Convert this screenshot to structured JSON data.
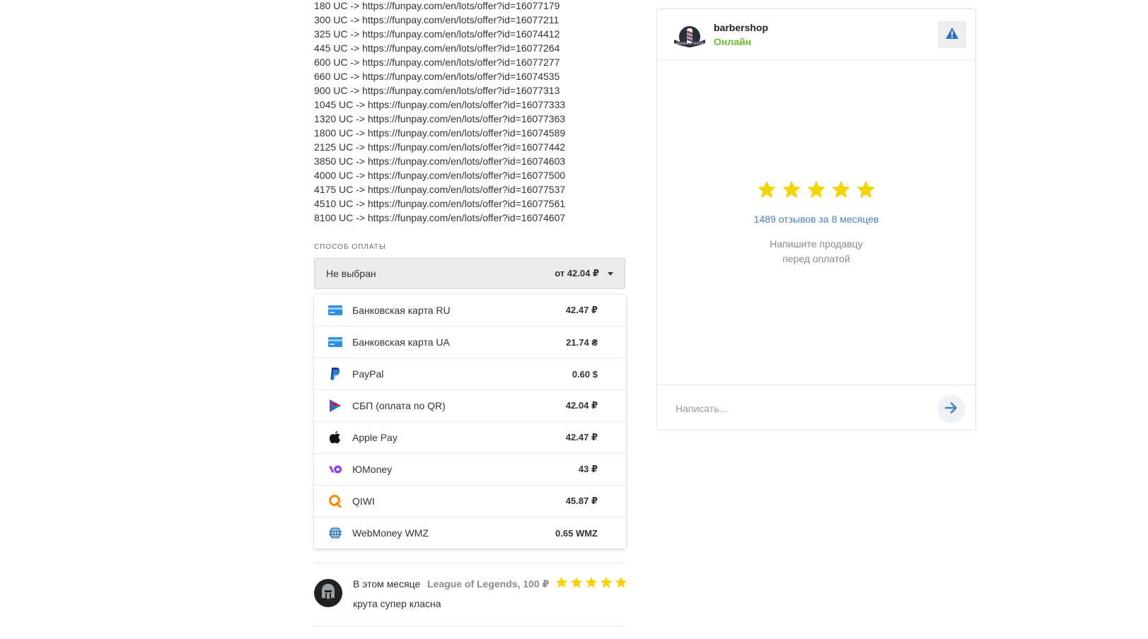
{
  "offers": [
    "180 UC -> https://funpay.com/en/lots/offer?id=16077179",
    "300 UC -> https://funpay.com/en/lots/offer?id=16077211",
    "325 UC -> https://funpay.com/en/lots/offer?id=16074412",
    "445 UC -> https://funpay.com/en/lots/offer?id=16077264",
    "600 UC -> https://funpay.com/en/lots/offer?id=16077277",
    "660 UC -> https://funpay.com/en/lots/offer?id=16074535",
    "900 UC -> https://funpay.com/en/lots/offer?id=16077313",
    "1045 UC -> https://funpay.com/en/lots/offer?id=16077333",
    "1320 UC -> https://funpay.com/en/lots/offer?id=16077363",
    "1800 UC -> https://funpay.com/en/lots/offer?id=16074589",
    "2125 UC -> https://funpay.com/en/lots/offer?id=16077442",
    "3850 UC -> https://funpay.com/en/lots/offer?id=16074603",
    "4000 UC -> https://funpay.com/en/lots/offer?id=16077500",
    "4175 UC -> https://funpay.com/en/lots/offer?id=16077537",
    "4510 UC -> https://funpay.com/en/lots/offer?id=16077561",
    "8100 UC -> https://funpay.com/en/lots/offer?id=16074607"
  ],
  "payment": {
    "label": "СПОСОБ ОПЛАТЫ",
    "selected": "Не выбран",
    "from_price": "от 42.04 ₽",
    "options": [
      {
        "name": "Банковская карта RU",
        "price": "42.47 ₽",
        "icon": "bank-card-icon"
      },
      {
        "name": "Банковская карта UA",
        "price": "21.74 ₴",
        "icon": "bank-card-icon"
      },
      {
        "name": "PayPal",
        "price": "0.60 $",
        "icon": "paypal-icon"
      },
      {
        "name": "СБП (оплата по QR)",
        "price": "42.04 ₽",
        "icon": "sbp-icon"
      },
      {
        "name": "Apple Pay",
        "price": "42.47 ₽",
        "icon": "apple-icon"
      },
      {
        "name": "ЮMoney",
        "price": "43 ₽",
        "icon": "yoomoney-icon"
      },
      {
        "name": "QIWI",
        "price": "45.87 ₽",
        "icon": "qiwi-icon"
      },
      {
        "name": "WebMoney WMZ",
        "price": "0.65 WMZ",
        "icon": "webmoney-icon"
      }
    ]
  },
  "review": {
    "date": "В этом месяце",
    "game": "League of Legends, 100 ₽",
    "rating": 5,
    "text": "крута супер класна"
  },
  "seller": {
    "name": "barbershop",
    "status": "Онлайн",
    "rating": 5,
    "reviews_link": "1489 отзывов за 8 месяцев",
    "hint_line1": "Напишите продавцу",
    "hint_line2": "перед оплатой",
    "message_placeholder": "Написать..."
  },
  "colors": {
    "star": "#f5d400",
    "online": "#6bbd2f",
    "link": "#4a7fbf",
    "send_arrow": "#4a7fbf"
  }
}
